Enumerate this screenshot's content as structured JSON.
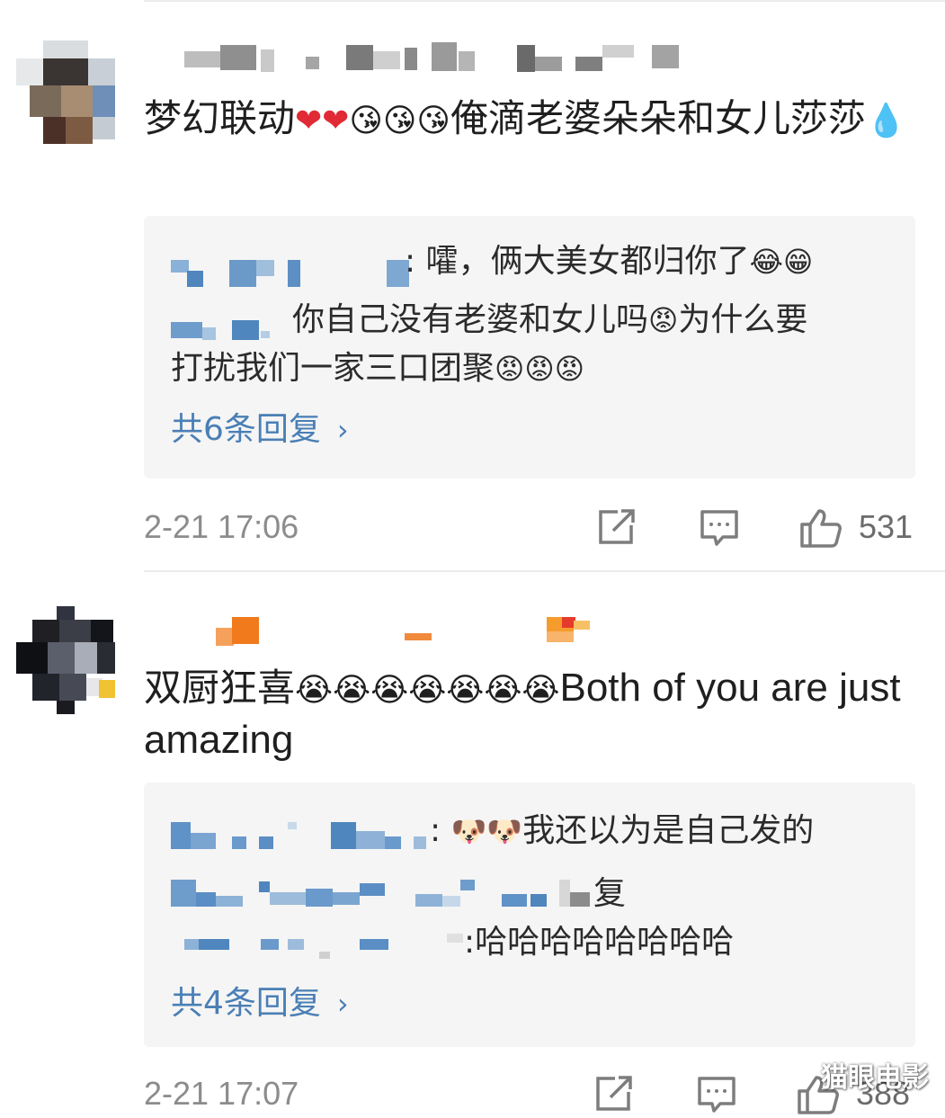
{
  "comments": [
    {
      "text_prefix": "梦幻联动",
      "emojis_a": "❤❤",
      "emojis_b": "😘😘😘",
      "text_mid": "俺滴老婆朵朵和女儿莎莎",
      "emoji_end": "💧",
      "replies": [
        {
          "sep": ": ",
          "text": "嚯，俩大美女都归你了",
          "emoji": "😂😁"
        },
        {
          "text": "你自己没有老婆和女儿吗",
          "emoji": "😡",
          "text2": "为什么要"
        },
        {
          "text": "打扰我们一家三口团聚",
          "emoji": "😡😡😡"
        }
      ],
      "more_replies": "共6条回复",
      "time": "2-21 17:06",
      "like_count": "531"
    },
    {
      "text_prefix": "双厨狂喜",
      "emojis_a": "😭😭😭😭😭😭😭",
      "text_en": "Both of you are just amazing",
      "replies": [
        {
          "sep": ": ",
          "emoji": "🐶🐶",
          "text": "我还以为是自己发的"
        },
        {
          "text": "复"
        },
        {
          "text": ":哈哈哈哈哈哈哈哈"
        }
      ],
      "more_replies": "共4条回复",
      "time": "2-21 17:07",
      "like_count": "388"
    }
  ],
  "icons": {
    "forward": "share-square-icon",
    "comment": "comment-bubble-icon",
    "like": "thumbs-up-icon"
  },
  "colors": {
    "link": "#4a7fb5",
    "time": "#8c8c8c",
    "reply_bg": "#f5f5f5"
  },
  "watermark": "猫眼电影"
}
